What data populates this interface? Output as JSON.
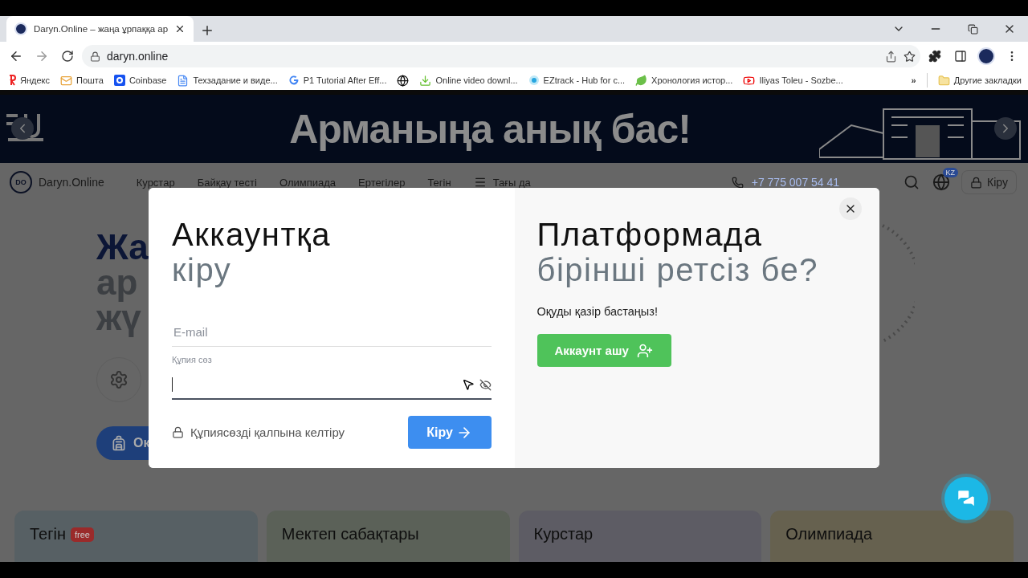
{
  "browser": {
    "tab": {
      "title": "Daryn.Online – жаңа ұрпаққа ар",
      "selected": true
    },
    "address": "daryn.online",
    "bookmarks": [
      {
        "kind": "link",
        "label": "Яндекс"
      },
      {
        "kind": "link",
        "label": "Пошта"
      },
      {
        "kind": "link",
        "label": "Coinbase"
      },
      {
        "kind": "link",
        "label": "Техзадание и виде..."
      },
      {
        "kind": "link",
        "label": "P1 Tutorial After Eff..."
      },
      {
        "kind": "icon"
      },
      {
        "kind": "link",
        "label": "Online video downl..."
      },
      {
        "kind": "link",
        "label": "EZtrack - Hub for c..."
      },
      {
        "kind": "link",
        "label": "Хронология истор..."
      },
      {
        "kind": "link",
        "label": "Iliyas Toleu - Sozbe..."
      }
    ],
    "overflow": "»",
    "other_bookmarks": "Другие закладки"
  },
  "banner": {
    "headline": "Арманыңа анық бас!"
  },
  "nav": {
    "logo_mark": "DO",
    "brand": "Daryn.Online",
    "links": [
      "Курстар",
      "Байқау тесті",
      "Олимпиада",
      "Ертегілер",
      "Тегін"
    ],
    "more": "Тағы да",
    "phone": "+7 775 007 54 41",
    "language": "KZ",
    "login": "Кіру"
  },
  "hero": {
    "lines": [
      {
        "text": "Жа",
        "color": "#0c1636"
      },
      {
        "text": "ар",
        "color": "#3c3f43"
      },
      {
        "text": "жү",
        "color": "#3c3f43"
      }
    ],
    "button": "Ок"
  },
  "cards": [
    {
      "title": "Тегін",
      "badge": "free",
      "color": "#576064"
    },
    {
      "title": "Мектеп сабақтары",
      "color": "#5b6158"
    },
    {
      "title": "Курстар",
      "color": "#5d5c64"
    },
    {
      "title": "Олимпиада",
      "color": "#66614f"
    }
  ],
  "modal": {
    "login": {
      "title": "Аккаунтқа",
      "subtitle": "кіру",
      "email": {
        "placeholder": "E-mail"
      },
      "password": {
        "label": "Құпия сөз",
        "focused": true
      },
      "reset_link": "Құпиясөзді қалпына келтіру",
      "submit": "Кіру"
    },
    "signup": {
      "title": "Платформада",
      "subtitle": "бірінші ретсіз бе?",
      "text": "Оқуды қазір бастаңыз!",
      "button": "Аккаунт ашу"
    }
  }
}
